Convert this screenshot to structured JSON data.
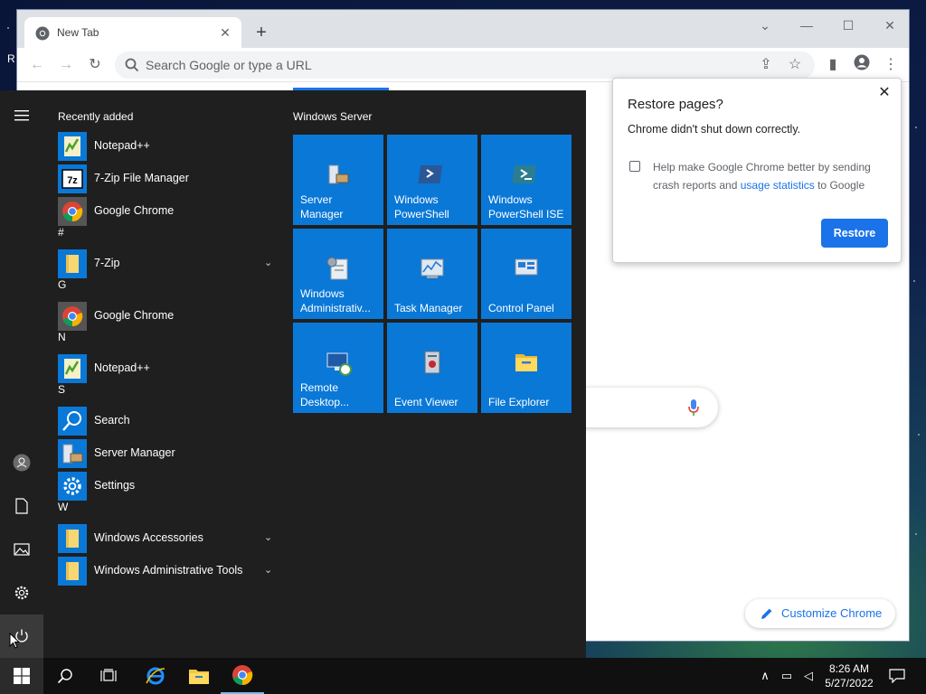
{
  "desktop": {
    "corner_text": "R"
  },
  "chrome": {
    "tab_title": "New Tab",
    "omnibox_placeholder": "Search Google or type a URL",
    "customize_label": "Customize Chrome"
  },
  "restore_dialog": {
    "title": "Restore pages?",
    "message": "Chrome didn't shut down correctly.",
    "help_text_before": "Help make Google Chrome better by sending crash reports and ",
    "help_link": "usage statistics",
    "help_text_after": " to Google",
    "checkbox_checked": false,
    "button_label": "Restore"
  },
  "start_menu": {
    "apps": [
      {
        "type": "section",
        "label": "Recently added"
      },
      {
        "type": "app",
        "label": "Notepad++",
        "icon": "notepadpp-icon"
      },
      {
        "type": "app",
        "label": "7-Zip File Manager",
        "icon": "7zip-icon"
      },
      {
        "type": "app",
        "label": "Google Chrome",
        "icon": "chrome-icon"
      },
      {
        "type": "section",
        "label": "#"
      },
      {
        "type": "folder",
        "label": "7-Zip",
        "icon": "folder-icon"
      },
      {
        "type": "section",
        "label": "G"
      },
      {
        "type": "app",
        "label": "Google Chrome",
        "icon": "chrome-icon"
      },
      {
        "type": "section",
        "label": "N"
      },
      {
        "type": "app",
        "label": "Notepad++",
        "icon": "notepadpp-icon"
      },
      {
        "type": "section",
        "label": "S"
      },
      {
        "type": "app",
        "label": "Search",
        "icon": "search-icon"
      },
      {
        "type": "app",
        "label": "Server Manager",
        "icon": "server-manager-icon"
      },
      {
        "type": "app",
        "label": "Settings",
        "icon": "gear-icon"
      },
      {
        "type": "section",
        "label": "W"
      },
      {
        "type": "folder",
        "label": "Windows Accessories",
        "icon": "folder-icon"
      },
      {
        "type": "folder",
        "label": "Windows Administrative Tools",
        "icon": "folder-icon"
      }
    ],
    "tiles_group": "Windows Server",
    "tiles": [
      {
        "label": "Server Manager",
        "icon": "server-manager-icon"
      },
      {
        "label": "Windows PowerShell",
        "icon": "powershell-icon"
      },
      {
        "label": "Windows PowerShell ISE",
        "icon": "powershell-ise-icon"
      },
      {
        "label": "Windows Administrativ...",
        "icon": "admin-tools-icon"
      },
      {
        "label": "Task Manager",
        "icon": "task-manager-icon"
      },
      {
        "label": "Control Panel",
        "icon": "control-panel-icon"
      },
      {
        "label": "Remote Desktop...",
        "icon": "remote-desktop-icon"
      },
      {
        "label": "Event Viewer",
        "icon": "event-viewer-icon"
      },
      {
        "label": "File Explorer",
        "icon": "file-explorer-icon"
      }
    ]
  },
  "taskbar": {
    "time": "8:26 AM",
    "date": "5/27/2022"
  },
  "colors": {
    "tile_blue": "#0a78d7",
    "chrome_blue": "#1a73e8",
    "start_bg": "#1f1f1f"
  }
}
